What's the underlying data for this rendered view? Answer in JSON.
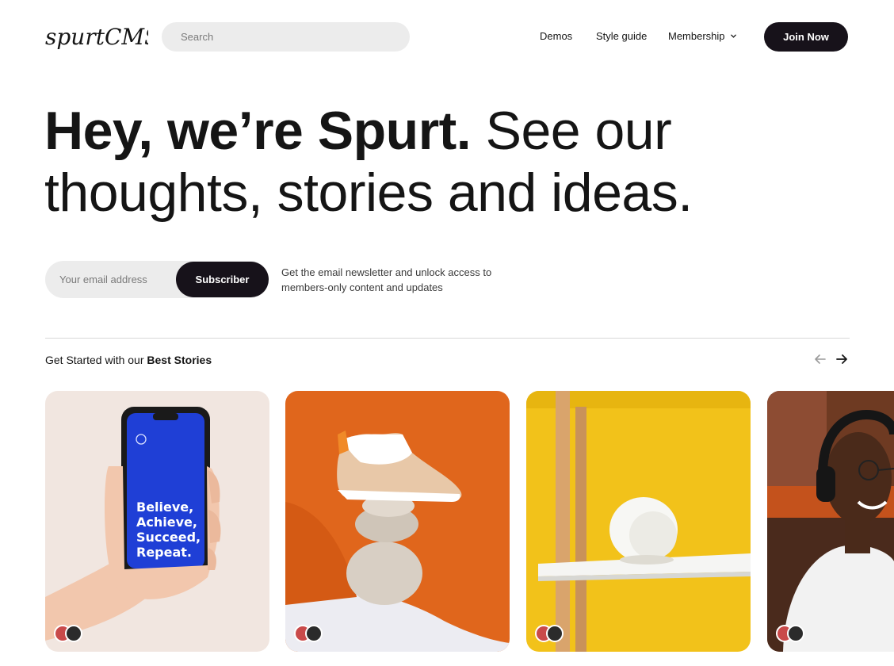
{
  "header": {
    "logo_text": "spurtCMS",
    "search_placeholder": "Search",
    "nav": {
      "demos": "Demos",
      "style_guide": "Style guide",
      "membership": "Membership"
    },
    "join_label": "Join Now"
  },
  "hero": {
    "bold_text": "Hey, we’re Spurt.",
    "light_text": " See our thoughts, stories and ideas."
  },
  "subscribe": {
    "email_placeholder": "Your email address",
    "button_label": "Subscriber",
    "note": "Get the email newsletter and unlock access to members-only content and updates"
  },
  "stories": {
    "title_prefix": "Get Started with our ",
    "title_bold": "Best Stories",
    "cards": [
      {
        "phone_text": "Believe, Achieve, Succeed, Repeat."
      },
      {},
      {},
      {}
    ]
  },
  "colors": {
    "accent_dark": "#17121a",
    "input_bg": "#ececec",
    "phone_screen": "#1f3fd6",
    "orange": "#e0661c",
    "yellow": "#f2c21a"
  }
}
